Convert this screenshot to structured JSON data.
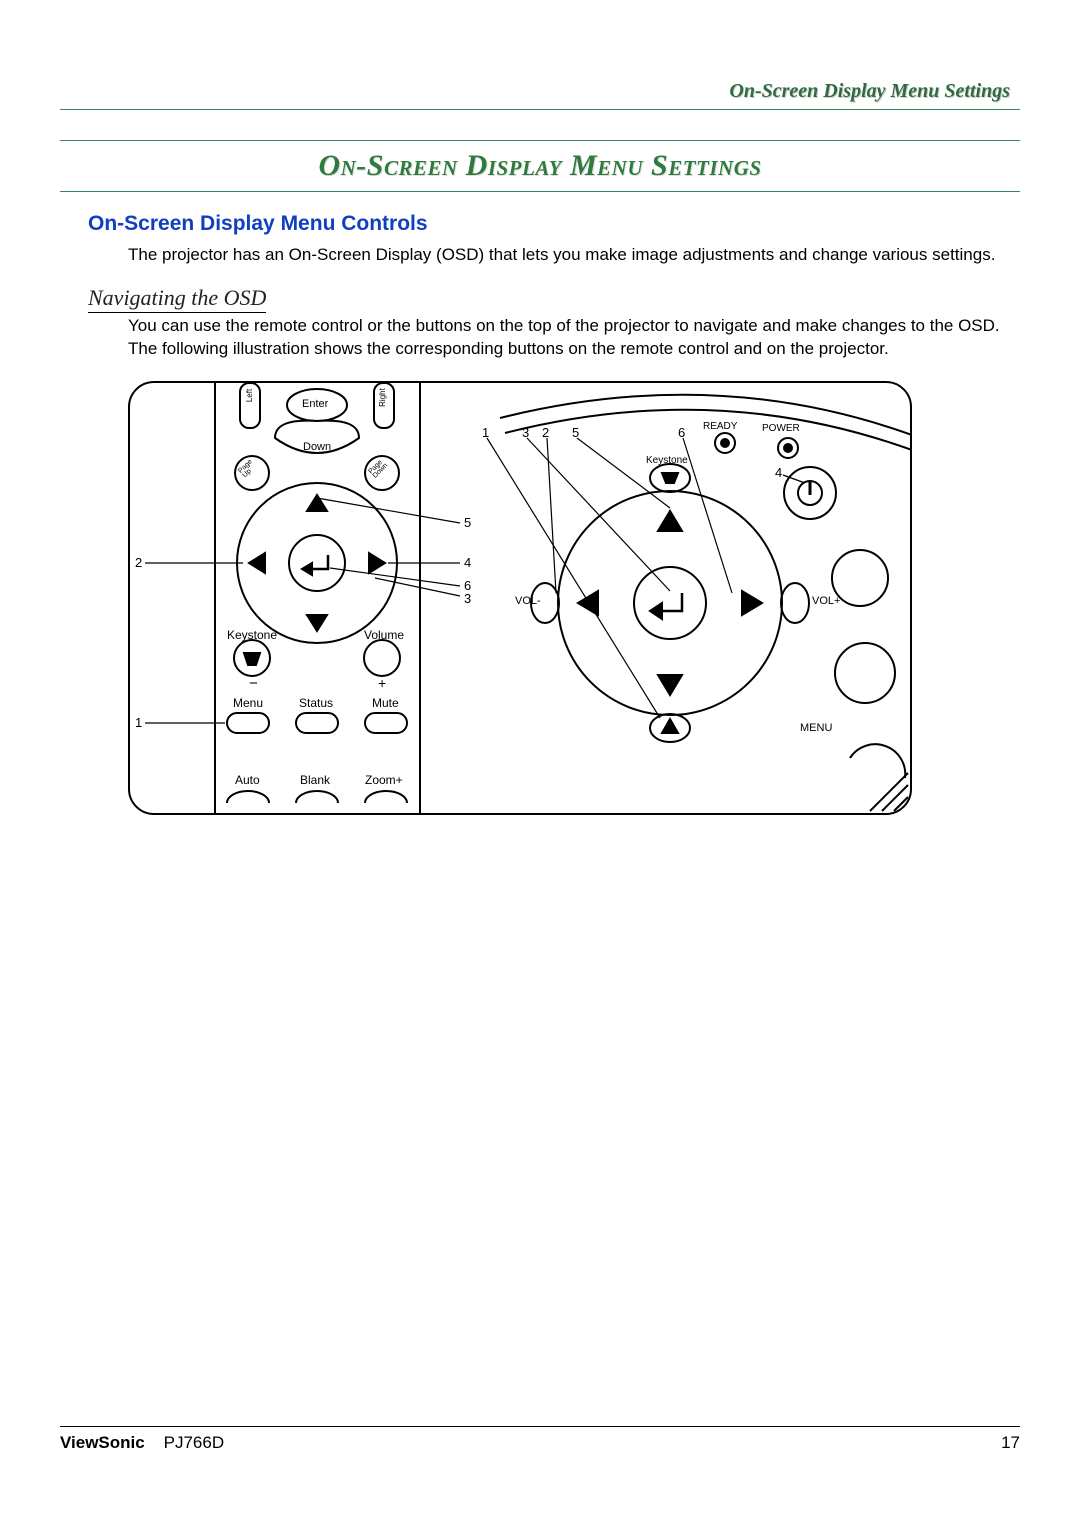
{
  "header": {
    "breadcrumb": "On-Screen Display Menu Settings"
  },
  "title": "On-Screen Display Menu Settings",
  "section1": {
    "heading": "On-Screen Display Menu Controls",
    "body": "The projector has an On-Screen Display (OSD) that lets you make image adjustments and change various settings."
  },
  "section2": {
    "heading": "Navigating the OSD",
    "body": "You can use the remote control or the buttons on the top of the projector to navigate and make changes to the OSD. The following illustration shows the corresponding buttons on the remote control and on the projector."
  },
  "illustration": {
    "remote": {
      "left": "Left",
      "enter": "Enter",
      "right": "Right",
      "down": "Down",
      "page_up": "Page Up",
      "page_down": "Page Down",
      "keystone": "Keystone",
      "volume": "Volume",
      "plus": "+",
      "minus": "−",
      "menu": "Menu",
      "status": "Status",
      "mute": "Mute",
      "auto": "Auto",
      "blank": "Blank",
      "zoom_plus": "Zoom+"
    },
    "projector": {
      "ready": "READY",
      "power": "POWER",
      "keystone": "Keystone",
      "vol_minus": "VOL-",
      "vol_plus": "VOL+",
      "menu": "MENU"
    },
    "callouts": {
      "c1": "1",
      "c2": "2",
      "c3": "3",
      "c4": "4",
      "c5": "5",
      "c6": "6"
    }
  },
  "footer": {
    "brand": "ViewSonic",
    "model": "PJ766D",
    "page": "17"
  }
}
